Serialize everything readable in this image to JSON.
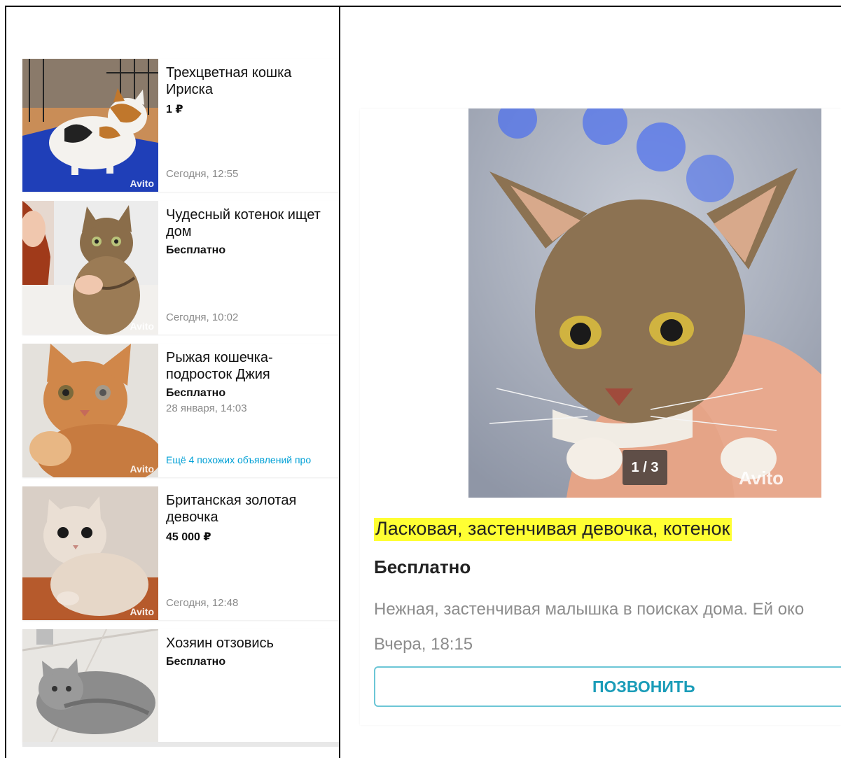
{
  "listings": [
    {
      "title": "Трехцветная кошка\nИриска",
      "price": "1 ₽",
      "date": "Сегодня, 12:55",
      "watermark": "Avito",
      "link": ""
    },
    {
      "title": "Чудесный котенок ищет\nдом",
      "price": "Бесплатно",
      "date": "Сегодня, 10:02",
      "watermark": "Avito",
      "link": ""
    },
    {
      "title": "Рыжая кошечка-\nподросток Джия",
      "price": "Бесплатно",
      "date": "28 января, 14:03",
      "watermark": "Avito",
      "link": "Ещё 4 похожих объявлений про"
    },
    {
      "title": "Британская золотая\nдевочка",
      "price": "45 000 ₽",
      "date": "Сегодня, 12:48",
      "watermark": "Avito",
      "link": ""
    },
    {
      "title": "Хозяин отзовись",
      "price": "Бесплатно",
      "date": "",
      "watermark": "",
      "link": ""
    }
  ],
  "detail": {
    "photo_counter": "1 / 3",
    "watermark": "Avito",
    "title": "Ласковая, застенчивая девочка, котенок",
    "price": "Бесплатно",
    "description": "Нежная, застенчивая малышка в поисках дома. Ей око",
    "date": "Вчера, 18:15",
    "call_label": "ПОЗВОНИТЬ"
  },
  "colors": {
    "highlight": "#ffff33",
    "link": "#00a0d6",
    "call_border": "#6cc6d6",
    "call_text": "#1a9cb8"
  }
}
